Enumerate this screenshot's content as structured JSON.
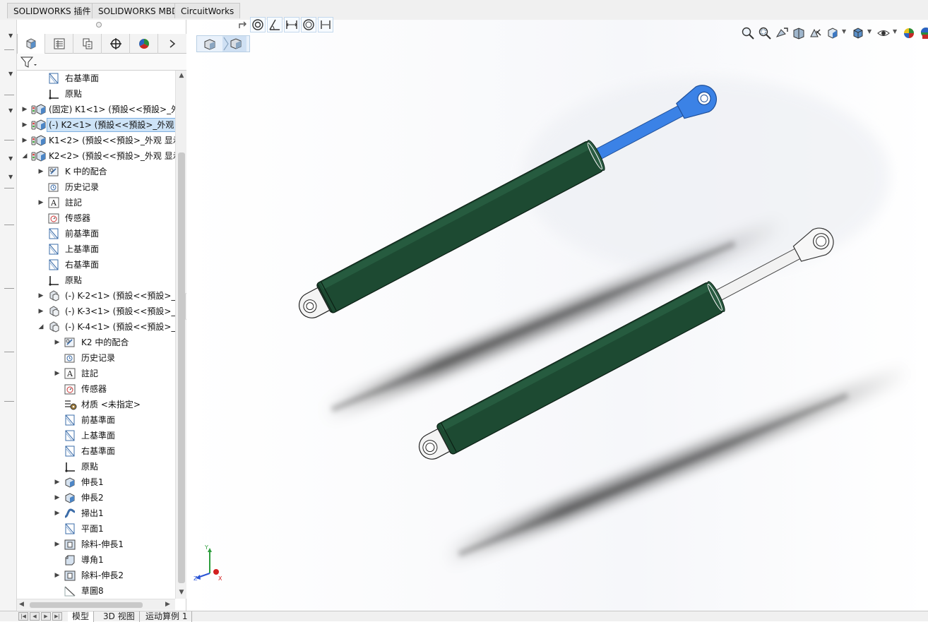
{
  "top_tabs": [
    "SOLIDWORKS 插件",
    "SOLIDWORKS MBD",
    "CircuitWorks"
  ],
  "feature_tabs": [
    "feature-manager",
    "property-manager",
    "configuration-manager",
    "dimxpert-manager",
    "display-manager"
  ],
  "tree": [
    {
      "label": "右基準面",
      "icon": "plane-icon",
      "expand": ""
    },
    {
      "label": "原點",
      "icon": "origin-icon",
      "expand": ""
    },
    {
      "label": "(固定) K1<1> (預設<<預設>_外",
      "icon": "part-icon",
      "expand": "▶"
    },
    {
      "label": "(-) K2<1> (預設<<預設>_外观",
      "icon": "part-icon",
      "expand": "▶",
      "selected": true
    },
    {
      "label": "K1<2> (預設<<預設>_外观 显示",
      "icon": "part-icon",
      "expand": "▶"
    },
    {
      "label": "K2<2> (預設<<預設>_外观 显示",
      "icon": "part-icon",
      "expand": "◢"
    },
    {
      "label": "K 中的配合",
      "icon": "mates-icon",
      "expand": "▶"
    },
    {
      "label": "历史记录",
      "icon": "history-icon",
      "expand": ""
    },
    {
      "label": "註記",
      "icon": "annotation-icon",
      "expand": "▶"
    },
    {
      "label": "传感器",
      "icon": "sensor-icon",
      "expand": ""
    },
    {
      "label": "前基準面",
      "icon": "plane-icon",
      "expand": ""
    },
    {
      "label": "上基準面",
      "icon": "plane-icon",
      "expand": ""
    },
    {
      "label": "右基準面",
      "icon": "plane-icon",
      "expand": ""
    },
    {
      "label": "原點",
      "icon": "origin-icon",
      "expand": ""
    },
    {
      "label": "(-) K-2<1> (預設<<預設>_",
      "icon": "subassembly-icon",
      "expand": "▶"
    },
    {
      "label": "(-) K-3<1> (預設<<預設>_",
      "icon": "subassembly-icon",
      "expand": "▶"
    },
    {
      "label": "(-) K-4<1> (預設<<預設>_",
      "icon": "subassembly-icon",
      "expand": "◢"
    },
    {
      "label": "K2 中的配合",
      "icon": "mates-icon",
      "expand": "▶"
    },
    {
      "label": "历史记录",
      "icon": "history-icon",
      "expand": ""
    },
    {
      "label": "註記",
      "icon": "annotation-icon",
      "expand": "▶"
    },
    {
      "label": "传感器",
      "icon": "sensor-icon",
      "expand": ""
    },
    {
      "label": "材质 <未指定>",
      "icon": "material-icon",
      "expand": ""
    },
    {
      "label": "前基準面",
      "icon": "plane-icon",
      "expand": ""
    },
    {
      "label": "上基準面",
      "icon": "plane-icon",
      "expand": ""
    },
    {
      "label": "右基準面",
      "icon": "plane-icon",
      "expand": ""
    },
    {
      "label": "原點",
      "icon": "origin-icon",
      "expand": ""
    },
    {
      "label": "伸長1",
      "icon": "extrude-icon",
      "expand": "▶"
    },
    {
      "label": "伸長2",
      "icon": "extrude-icon",
      "expand": "▶"
    },
    {
      "label": "掃出1",
      "icon": "sweep-icon",
      "expand": "▶"
    },
    {
      "label": "平面1",
      "icon": "plane-icon",
      "expand": ""
    },
    {
      "label": "除料-伸長1",
      "icon": "cut-extrude-icon",
      "expand": "▶"
    },
    {
      "label": "導角1",
      "icon": "chamfer-icon",
      "expand": ""
    },
    {
      "label": "除料-伸長2",
      "icon": "cut-extrude-icon",
      "expand": "▶"
    },
    {
      "label": "草圖8",
      "icon": "sketch-icon",
      "expand": ""
    }
  ],
  "bottom_tabs": [
    "模型",
    "3D 视图",
    "运动算例 1"
  ],
  "triad": {
    "x": "X",
    "y": "Y",
    "z": "Z"
  },
  "colors": {
    "cylinder_body": "#1d4a32",
    "rod_selected": "#3b82e6",
    "rod_default": "#f2f2f2",
    "selection": "#cde3f7",
    "hud_icon": "#4a6c8c"
  },
  "hud_icons": [
    "zoom-to-fit-icon",
    "zoom-area-icon",
    "previous-view-icon",
    "section-view-icon",
    "dynamic-annotation-icon",
    "view-orientation-icon",
    "display-style-icon",
    "hide-show-icon",
    "edit-appearance-icon",
    "apply-scene-icon",
    "view-settings-icon"
  ],
  "view_toolbar_icons": [
    "rotate-icon",
    "concentric-mate-icon",
    "angle-mate-icon",
    "distance-mate-icon",
    "concentric-icon",
    "width-mate-icon"
  ],
  "config_icons": [
    "part-view-icon",
    "assembly-view-icon"
  ]
}
